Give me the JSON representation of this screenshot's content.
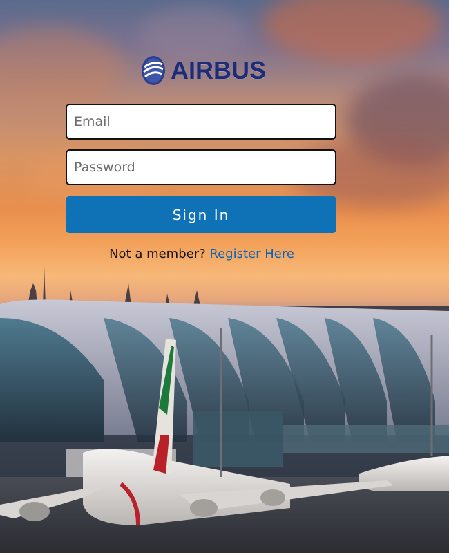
{
  "brand": {
    "name": "AIRBUS",
    "logo_icon": "airbus-globe-icon",
    "color": "#1b2d7a"
  },
  "form": {
    "email": {
      "value": "",
      "placeholder": "Email"
    },
    "password": {
      "value": "",
      "placeholder": "Password"
    },
    "submit_label": "Sign In",
    "submit_color": "#0f72b7"
  },
  "footer": {
    "prompt": "Not a member?",
    "register_label": "Register Here",
    "link_color": "#0b63b5"
  },
  "background": {
    "description_icon": "airport-sunset-image"
  }
}
